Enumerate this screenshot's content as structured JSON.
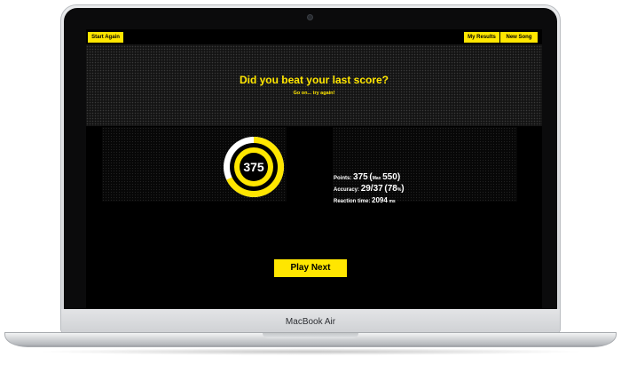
{
  "device": {
    "brand_label": "MacBook Air"
  },
  "header": {
    "start_again": "Start Again",
    "my_results": "My Results",
    "new_song": "New Song"
  },
  "main": {
    "title": "Did you beat your last score?",
    "subtitle": "Go on... try again!"
  },
  "score": {
    "value": "375",
    "ring_fill_fraction": 0.68
  },
  "stats": {
    "points_label": "Points:",
    "points_value": "375",
    "max_open": "(",
    "max_label": "Max",
    "max_value": "550",
    "max_close": ")",
    "accuracy_label": "Accuracy:",
    "accuracy_value": "29/37",
    "accuracy_pct_open": "(78",
    "accuracy_pct_unit": "%",
    "accuracy_pct_close": ")",
    "reaction_label": "Reaction time:",
    "reaction_value": "2094",
    "reaction_unit": "ms"
  },
  "actions": {
    "play_next": "Play Next"
  },
  "colors": {
    "accent": "#ffe600",
    "background": "#000000",
    "text": "#ffffff"
  }
}
